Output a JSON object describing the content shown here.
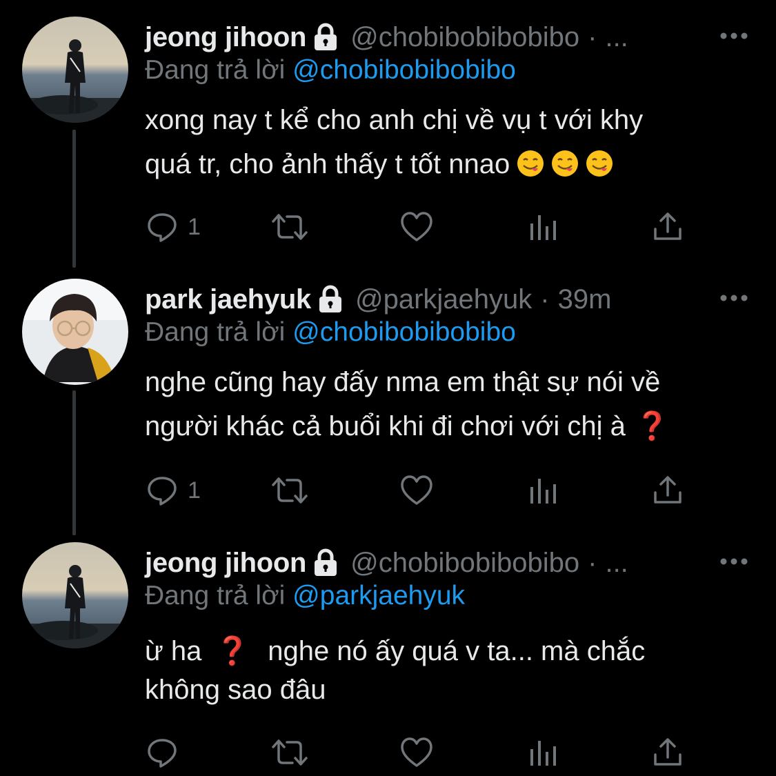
{
  "tweets": [
    {
      "display_name": "jeong jihoon",
      "handle": "@chobibobibobibo",
      "separator": "·",
      "time": "...",
      "reply_prefix": "Đang trả lời",
      "reply_to": "@chobibobibobibo",
      "text_lines": [
        "xong nay t kể cho anh chị về vụ t với khy",
        "quá tr, cho ảnh thấy t tốt nnao"
      ],
      "emojis": [
        "face-savoring-food-icon",
        "face-savoring-food-icon",
        "face-savoring-food-icon"
      ],
      "reply_count": "1",
      "locked": true
    },
    {
      "display_name": "park jaehyuk",
      "handle": "@parkjaehyuk",
      "separator": "·",
      "time": "39m",
      "reply_prefix": "Đang trả lời",
      "reply_to": "@chobibobibobibo",
      "text_lines": [
        "nghe cũng hay đấy nma em thật sự nói về",
        "người khác cả buổi khi đi chơi với chị à"
      ],
      "trailing_mark": "❓",
      "reply_count": "1",
      "locked": true
    },
    {
      "display_name": "jeong jihoon",
      "handle": "@chobibobibobibo",
      "separator": "·",
      "time": "...",
      "reply_prefix": "Đang trả lời",
      "reply_to": "@parkjaehyuk",
      "text_line1_a": "ừ ha",
      "text_mark": "❓",
      "text_line1_b": "nghe nó ấy quá v ta... mà chắc",
      "text_line2": "không sao đâu",
      "reply_count": "",
      "locked": true
    }
  ],
  "colors": {
    "background": "#000000",
    "primary_text": "#e7e9ea",
    "secondary_text": "#71767b",
    "link": "#1d9bf0",
    "thread_line": "#333639",
    "question_mark": "#e0245e"
  },
  "icons": {
    "reply": "reply-icon",
    "retweet": "retweet-icon",
    "like": "like-icon",
    "views": "views-icon",
    "share": "share-icon",
    "more": "more-icon",
    "lock": "lock-icon"
  }
}
